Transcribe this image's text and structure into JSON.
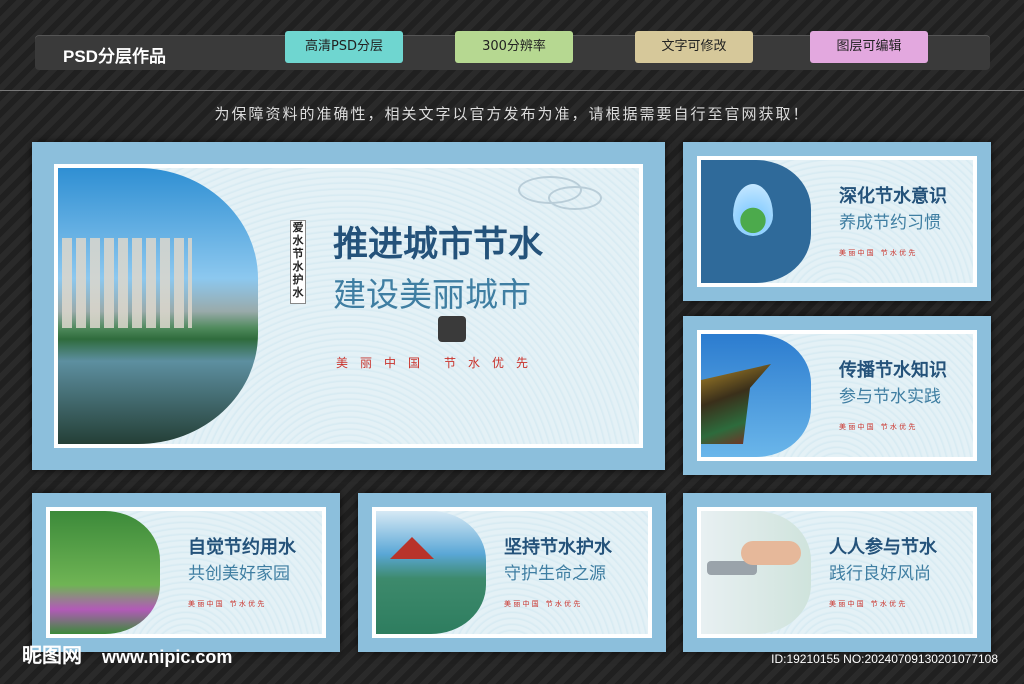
{
  "header": {
    "title": "PSD分层作品",
    "tags": [
      "高清PSD分层",
      "300分辨率",
      "文字可修改",
      "图层可编辑"
    ]
  },
  "notice": "为保障资料的准确性，相关文字以官方发布为准，请根据需要自行至官网获取！",
  "main_board": {
    "vertical": "爱水节水护水",
    "headline": "推进城市节水",
    "subline": "建设美丽城市",
    "motto": "美　丽　中　国　　节　水　优　先"
  },
  "boards": [
    {
      "headline": "深化节水意识",
      "subline": "养成节约习惯",
      "motto": "美 丽 中 国　节 水 优 先"
    },
    {
      "headline": "传播节水知识",
      "subline": "参与节水实践",
      "motto": "美 丽 中 国　节 水 优 先"
    },
    {
      "headline": "自觉节约用水",
      "subline": "共创美好家园",
      "motto": "美 丽 中 国　节 水 优 先"
    },
    {
      "headline": "坚持节水护水",
      "subline": "守护生命之源",
      "motto": "美 丽 中 国　节 水 优 先"
    },
    {
      "headline": "人人参与节水",
      "subline": "践行良好风尚",
      "motto": "美 丽 中 国　节 水 优 先"
    }
  ],
  "footer": {
    "logo": "昵图网",
    "url": "www.nipic.com",
    "id": "ID:19210155 NO:20240709130201077108"
  }
}
